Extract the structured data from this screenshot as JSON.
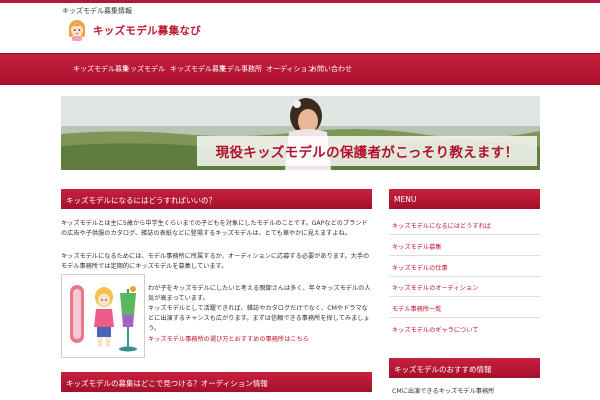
{
  "header": {
    "tagline": "キッズモデル募集情報",
    "site_title": "キッズモデル募集なび"
  },
  "nav": {
    "items": [
      "キッズモデル募集",
      "キッズモデル",
      "キッズモデル募集",
      "モデル事務所",
      "オーディション",
      "お問い合わせ"
    ]
  },
  "hero": {
    "caption": "現役キッズモデルの保護者がこっそり教えます！"
  },
  "main": {
    "section1_title": "キッズモデルになるにはどうすればいいの？",
    "para1": "キッズモデルとは主に5歳から中学生くらいまでの子どもを対象にしたモデルのことです。GAPなどのブランドの広告や子供服のカタログ、雑誌の表紙などに登場するキッズモデルは、とても華やかに見えますよね。",
    "para2": "キッズモデルになるためには、モデル事務所に所属するか、オーディションに応募する必要があります。大手のモデル事務所では定期的にキッズモデルを募集しています。",
    "para3": "わが子をキッズモデルにしたいと考える親御さんは多く、年々キッズモデルの人気が高まっています。",
    "para4": "キッズモデルとして活躍できれば、雑誌やカタログだけでなく、CMやドラマなどに出演するチャンスも広がります。まずは信頼できる事務所を探してみましょう。",
    "red_link": "キッズモデル事務所の選び方とおすすめの事務所はこちら",
    "section2_title": "キッズモデルの募集はどこで見つける？オーディション情報"
  },
  "sidebar": {
    "menu_title": "MENU",
    "menu_items": [
      "キッズモデルになるにはどうすれば",
      "キッズモデル募集",
      "キッズモデルの仕事",
      "キッズモデルのオーディション",
      "モデル事務所一覧",
      "キッズモデルのギャラについて"
    ],
    "box2_title": "キッズモデルのおすすめ情報",
    "box2_text": "CMに出演できるキッズモデル事務所"
  },
  "colors": {
    "brand_red": "#b5153a",
    "nav_gradient_top": "#c8203f",
    "nav_gradient_bottom": "#a8102c",
    "text": "#333333"
  },
  "icons": {
    "logo": "girl-face-icon",
    "thumbnail": "kids-fashion-illustration"
  }
}
